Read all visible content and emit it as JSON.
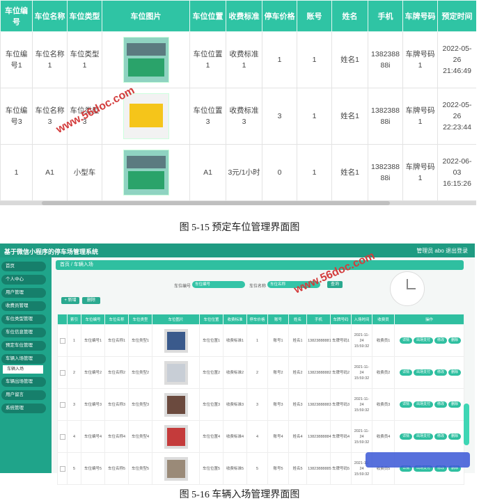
{
  "fig1": {
    "headers": [
      "车位编号",
      "车位名称",
      "车位类型",
      "车位图片",
      "车位位置",
      "收费标准",
      "停车价格",
      "账号",
      "姓名",
      "手机",
      "车牌号码",
      "预定时间"
    ],
    "rows": [
      {
        "no": "车位编号1",
        "name": "车位名称1",
        "type": "车位类型1",
        "pos": "车位位置1",
        "fee": "收费标准1",
        "price": "1",
        "acct": "1",
        "uname": "姓名1",
        "phone": "1382388 88i",
        "plate": "车牌号码1",
        "time": "2022-05-26 21:46:49",
        "pic": "parking-photo"
      },
      {
        "no": "车位编号3",
        "name": "车位名称3",
        "type": "车位类型3",
        "pos": "车位位置3",
        "fee": "收费标准3",
        "price": "3",
        "acct": "1",
        "uname": "姓名1",
        "phone": "1382388 88i",
        "plate": "车牌号码1",
        "time": "2022-05-26 22:23:44",
        "pic": "parking-sign-photo"
      },
      {
        "no": "1",
        "name": "A1",
        "type": "小型车",
        "pos": "A1",
        "fee": "3元/1小时",
        "price": "0",
        "acct": "1",
        "uname": "姓名1",
        "phone": "1382388 88i",
        "plate": "车牌号码1",
        "time": "2022-06-03 16:15:26",
        "pic": "parking-photo"
      }
    ],
    "watermark": "www.56doc.com"
  },
  "caption1": "图 5-15 预定车位管理界面图",
  "fig2": {
    "app_title": "基于微信小程序的停车场管理系统",
    "top_right": "管理员 abo    退出登录",
    "sidebar": [
      "首页",
      "个人中心",
      "用户管理",
      "收费员管理",
      "车位类型管理",
      "车位信息管理",
      "预定车位管理",
      "车辆入场管理",
      "车辆出场管理",
      "用户留言",
      "系统管理"
    ],
    "sidebar_sub": "车辆入场",
    "breadcrumb": "首页 / 车辆入场",
    "search": [
      {
        "label": "车位编号",
        "placeholder": "车位编号"
      },
      {
        "label": "车位名称",
        "placeholder": "车位名称"
      }
    ],
    "query_btn": "查询",
    "add_btn": "+ 新增",
    "del_btn": "删除",
    "headers": [
      "",
      "索引",
      "车位编号",
      "车位名称",
      "车位类型",
      "车位图片",
      "车位位置",
      "收费标准",
      "停车价格",
      "账号",
      "姓名",
      "手机",
      "车牌号码",
      "入场时间",
      "收费员",
      "操作"
    ],
    "rows": [
      {
        "idx": "1",
        "no": "车位编号1",
        "name": "车位名称1",
        "type": "车位类型1",
        "pos": "车位位置1",
        "fee": "收费标准1",
        "price": "1",
        "acct": "账号1",
        "uname": "姓名1",
        "phone": "13823888881",
        "plate": "车牌号码1",
        "time": "2021-11-24 15:59:32",
        "staff": "收费员1",
        "ops": [
          "详情",
          "出场支付",
          "修改",
          "删除"
        ]
      },
      {
        "idx": "2",
        "no": "车位编号2",
        "name": "车位名称2",
        "type": "车位类型2",
        "pos": "车位位置2",
        "fee": "收费标准2",
        "price": "2",
        "acct": "账号2",
        "uname": "姓名2",
        "phone": "13823888882",
        "plate": "车牌号码2",
        "time": "2021-11-24 15:59:32",
        "staff": "收费员2",
        "ops": [
          "详情",
          "出场支付",
          "修改",
          "删除"
        ]
      },
      {
        "idx": "3",
        "no": "车位编号3",
        "name": "车位名称3",
        "type": "车位类型3",
        "pos": "车位位置3",
        "fee": "收费标准3",
        "price": "3",
        "acct": "账号3",
        "uname": "姓名3",
        "phone": "13823888883",
        "plate": "车牌号码3",
        "time": "2021-11-24 15:59:32",
        "staff": "收费员3",
        "ops": [
          "详情",
          "出场支付",
          "修改",
          "删除"
        ]
      },
      {
        "idx": "4",
        "no": "车位编号4",
        "name": "车位名称4",
        "type": "车位类型4",
        "pos": "车位位置4",
        "fee": "收费标准4",
        "price": "4",
        "acct": "账号4",
        "uname": "姓名4",
        "phone": "13823888884",
        "plate": "车牌号码4",
        "time": "2021-11-24 15:59:32",
        "staff": "收费员4",
        "ops": [
          "详情",
          "出场支付",
          "修改",
          "删除"
        ]
      },
      {
        "idx": "5",
        "no": "车位编号5",
        "name": "车位名称5",
        "type": "车位类型5",
        "pos": "车位位置5",
        "fee": "收费标准5",
        "price": "5",
        "acct": "账号5",
        "uname": "姓名5",
        "phone": "13823888885",
        "plate": "车牌号码5",
        "time": "2021-11-24 15:59:32",
        "staff": "收费员5",
        "ops": [
          "详情",
          "出场支付",
          "修改",
          "删除"
        ]
      }
    ],
    "watermark": "www.56doc.com"
  },
  "caption2": "图 5-16 车辆入场管理界面图"
}
